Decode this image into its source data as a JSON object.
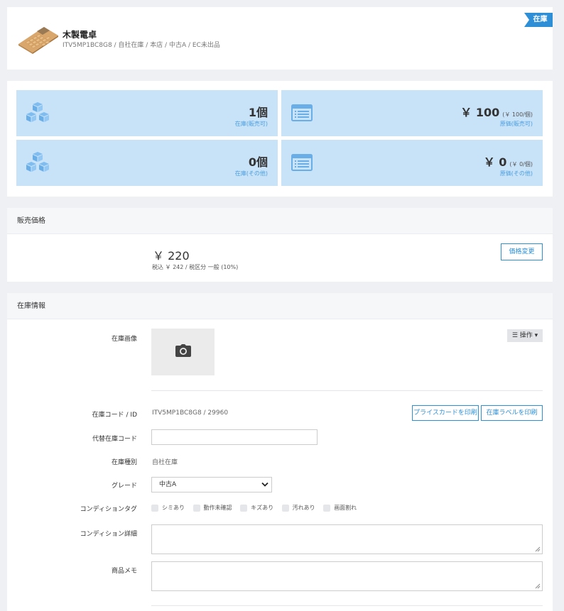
{
  "header": {
    "product_name": "木製電卓",
    "product_sub": "ITV5MP1BC8G8 / 自社在庫 / 本店 / 中古A / EC未出品",
    "status_ribbon": "在庫"
  },
  "stats": [
    {
      "value": "1個",
      "unit": "",
      "label": "在庫(販売可)",
      "icon": "boxes-icon"
    },
    {
      "value": "￥ 100",
      "unit": "(￥ 100/個)",
      "label": "原価(販売可)",
      "icon": "list-icon"
    },
    {
      "value": "0個",
      "unit": "",
      "label": "在庫(その他)",
      "icon": "boxes-icon"
    },
    {
      "value": "￥ 0",
      "unit": "(￥ 0/個)",
      "label": "原価(その他)",
      "icon": "list-icon"
    }
  ],
  "price_section": {
    "title": "販売価格",
    "price": "￥ 220",
    "tax_line": "税込 ￥ 242 / 税区分 一般 (10%)",
    "change_button": "価格変更"
  },
  "stock_section": {
    "title": "在庫情報",
    "image_label": "在庫画像",
    "operation_button": "☰ 操作 ▾",
    "code_label": "在庫コード / ID",
    "code_value": "ITV5MP1BC8G8 / 29960",
    "print_price_card": "プライスカードを印刷",
    "print_label": "在庫ラベルを印刷",
    "alt_code_label": "代替在庫コード",
    "alt_code_value": "",
    "type_label": "在庫種別",
    "type_value": "自社在庫",
    "grade_label": "グレード",
    "grade_value": "中古A",
    "condition_tag_label": "コンディションタグ",
    "condition_tags": [
      "シミあり",
      "動作未確認",
      "キズあり",
      "汚れあり",
      "画面割れ"
    ],
    "condition_detail_label": "コンディション詳細",
    "memo_label": "商品メモ"
  },
  "colors": {
    "accent": "#2e8fd6",
    "stat_bg": "#c8e2f8",
    "page_bg": "#eef0f3"
  }
}
